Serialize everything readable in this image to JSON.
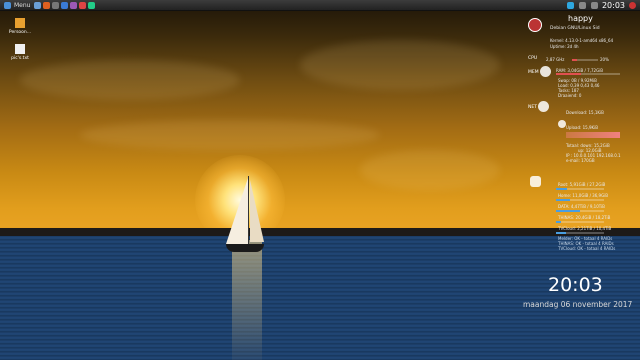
{
  "panel": {
    "menu_label": "Menu",
    "clock": "20:03"
  },
  "desktop_icons": [
    {
      "label": "Persoon..."
    },
    {
      "label": "pic's.txt"
    }
  ],
  "conky": {
    "user": "happy",
    "distro": "Debian GNU/Linux Sid",
    "kernel": "Kernel: 4.13.0-1-amd64 x86_64",
    "uptime": "Uptime: 2d 4h",
    "cpu_label": "CPU",
    "cpu_freq": "2,87 GHz",
    "cpu_percent": "20%",
    "mem_label": "MEM",
    "ram": "RAM: 3,04GiB / 7,72GiB",
    "swap": "Swap: 0B  / 9,92MiB",
    "load": "Load: 0,39 0,43 0,46",
    "tasks": "Tasks: 187",
    "threads": "Draaiend: 0",
    "net_label": "NET",
    "download": "Download: 15,1KiB",
    "upload": "Upload: 15,9KiB",
    "total_down": "Totaal: down: 15,2GiB",
    "total_up": "up: 12,0GiB",
    "ip": "IP    : 10.0.0.101 192.168.0.1",
    "email": "e-mail: 170GB",
    "disk_root": "Root: 5,91GiB / 27,2GiB",
    "disk_home": "Home: 11,0GiB / 36,9GiB",
    "disk_data": "DATA: 4,47TiB / 9,10TiB",
    "disk_things": "THINAS: 20,4GiB / 18,2TiB",
    "disk_tvcloud": "TVCloud: 2,21TiB / 10,4TiB",
    "status1": "Melder: OK - totaal 4 RAIDs",
    "status2": "THINAS: OK - totaal 4 RAIDs",
    "status3": "TVCloud: OK - totaal 4 RAIDs"
  },
  "big_clock": "20:03",
  "big_date": "maandag 06 november 2017"
}
